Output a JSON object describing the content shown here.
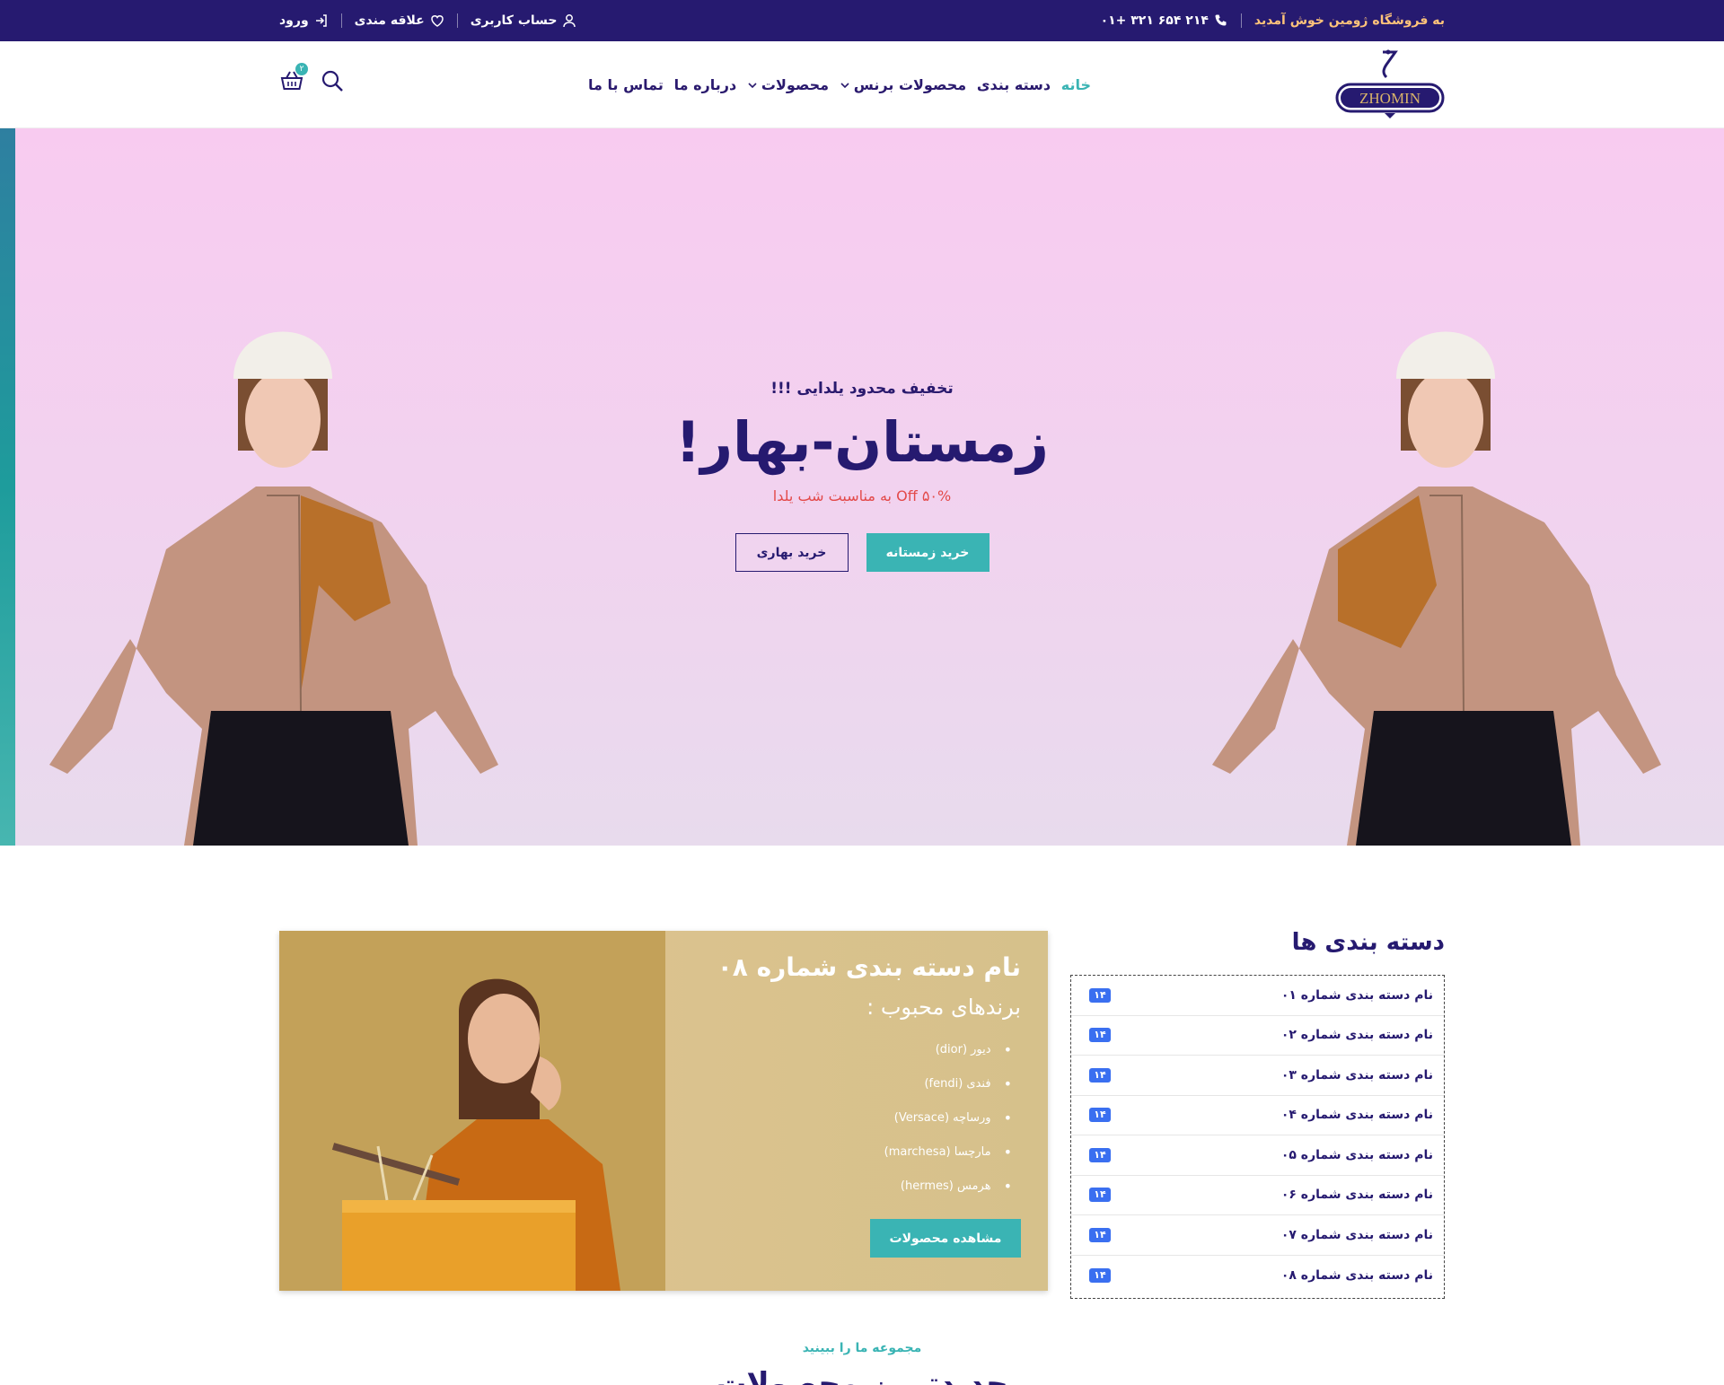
{
  "topbar": {
    "welcome": "به فروشگاه ژومین خوش آمدید",
    "phone": "۰۱+ ۳۲۱ ۶۵۴ ۲۱۴",
    "account": "حساب کاربری",
    "wishlist": "علاقه مندی",
    "login": "ورود"
  },
  "header": {
    "logo_text": "ZHOMIN",
    "nav": [
      "خانه",
      "دسته بندی",
      "محصولات برنس",
      "محصولات",
      "درباره ما",
      "تماس با ما"
    ],
    "cart_count": "۲"
  },
  "hero": {
    "kicker": "تخفیف محدود یلدایی !!!",
    "title": "زمستان-بهار!",
    "subtitle": "۵۰% Off به مناسبت شب یلدا",
    "btn_winter": "خرید زمستانه",
    "btn_spring": "خرید بهاری"
  },
  "categories": {
    "heading": "دسته بندی ها",
    "items": [
      {
        "name": "نام دسته بندی شماره ۰۱",
        "count": "۱۴"
      },
      {
        "name": "نام دسته بندی شماره ۰۲",
        "count": "۱۴"
      },
      {
        "name": "نام دسته بندی شماره ۰۳",
        "count": "۱۴"
      },
      {
        "name": "نام دسته بندی شماره ۰۴",
        "count": "۱۴"
      },
      {
        "name": "نام دسته بندی شماره ۰۵",
        "count": "۱۴"
      },
      {
        "name": "نام دسته بندی شماره ۰۶",
        "count": "۱۴"
      },
      {
        "name": "نام دسته بندی شماره ۰۷",
        "count": "۱۴"
      },
      {
        "name": "نام دسته بندی شماره ۰۸",
        "count": "۱۴"
      }
    ]
  },
  "feature": {
    "title": "نام دسته بندی شماره ۰۸",
    "subtitle": "برندهای محبوب :",
    "brands": [
      "دیور (dior)",
      "فندی (fendi)",
      "ورساچه (Versace)",
      "مارچسا (marchesa)",
      "هرمس (hermes)"
    ],
    "button": "مشاهده محصولات"
  },
  "collection": {
    "kicker": "مجموعه ما را ببینید",
    "title": "جدیدترین محصولات"
  },
  "colors": {
    "navy": "#261a70",
    "teal": "#3ab4b4",
    "accent_orange": "#ffc37a",
    "sale_red": "#e34a4a",
    "badge_blue": "#3a6ff0"
  }
}
